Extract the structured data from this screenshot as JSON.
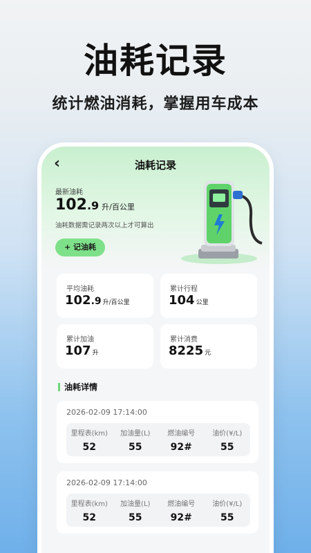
{
  "hero": {
    "title": "油耗记录",
    "subtitle": "统计燃油消耗，掌握用车成本"
  },
  "nav": {
    "back_icon": "chevron-left-icon",
    "title": "油耗记录"
  },
  "latest": {
    "label": "最新油耗",
    "value_int": "102",
    "value_dec": ".9",
    "unit": "升/百公里",
    "note": "油耗数据需记录两次以上才可算出",
    "add_button": "+ 记油耗"
  },
  "stats": [
    {
      "label": "平均油耗",
      "value": "102",
      "value_dec": ".9",
      "unit": "升/百公里"
    },
    {
      "label": "累计行程",
      "value": "104",
      "value_dec": "",
      "unit": "公里"
    },
    {
      "label": "累计加油",
      "value": "107",
      "value_dec": "",
      "unit": "升"
    },
    {
      "label": "累计消费",
      "value": "8225",
      "value_dec": "",
      "unit": "元"
    }
  ],
  "details": {
    "title": "油耗详情",
    "columns": [
      "里程表(km)",
      "加油量(L)",
      "燃油编号",
      "油价(¥/L)"
    ],
    "records": [
      {
        "date": "2026-02-09 17:14:00",
        "values": [
          "52",
          "55",
          "92#",
          "55"
        ]
      },
      {
        "date": "2026-02-09 17:14:00",
        "values": [
          "52",
          "55",
          "92#",
          "55"
        ]
      }
    ]
  },
  "colors": {
    "accent": "#7fe08a",
    "header_gradient": "#c9efcf",
    "page_bg": "#f5f6f7"
  }
}
